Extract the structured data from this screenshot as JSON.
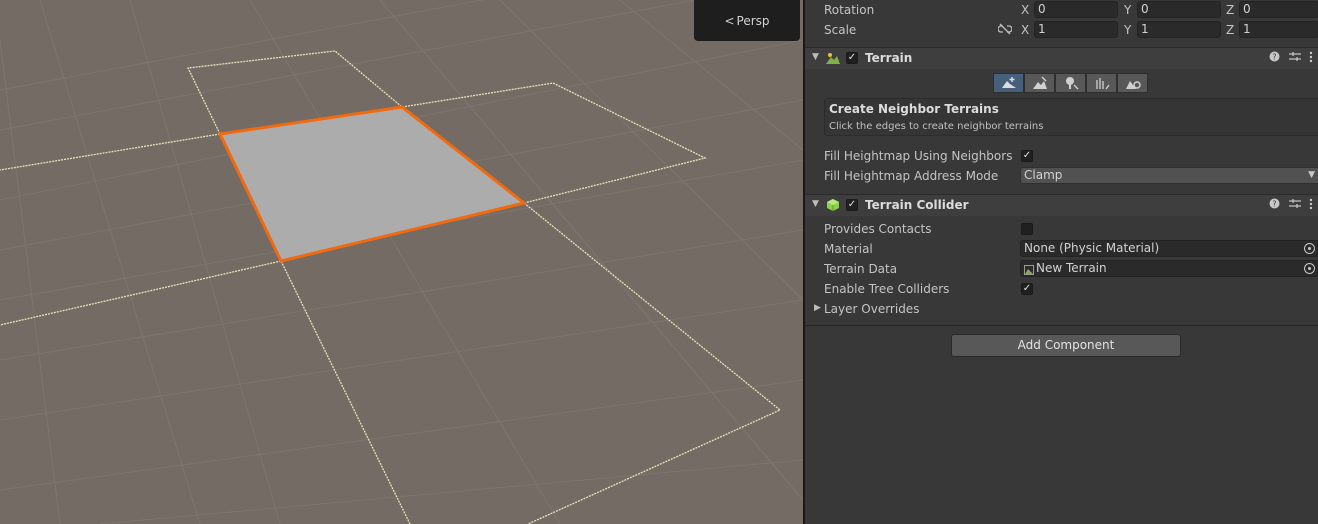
{
  "scene_view": {
    "persp_label": "Persp"
  },
  "transform": {
    "rotation": {
      "label": "Rotation",
      "x_axis": "X",
      "y_axis": "Y",
      "z_axis": "Z",
      "x": "0",
      "y": "0",
      "z": "0"
    },
    "scale": {
      "label": "Scale",
      "x_axis": "X",
      "y_axis": "Y",
      "z_axis": "Z",
      "x": "1",
      "y": "1",
      "z": "1"
    }
  },
  "terrain": {
    "title": "Terrain",
    "enabled": true,
    "tools": [
      "create-neighbor-terrains-tool",
      "paint-terrain-tool",
      "paint-trees-tool",
      "paint-details-tool",
      "terrain-settings-tool"
    ],
    "active_tool": 0,
    "info_title": "Create Neighbor Terrains",
    "info_text": "Click the edges to create neighbor terrains",
    "fill_heightmap_label": "Fill Heightmap Using Neighbors",
    "fill_heightmap_checked": true,
    "address_mode_label": "Fill Heightmap Address Mode",
    "address_mode_value": "Clamp"
  },
  "terrain_collider": {
    "title": "Terrain Collider",
    "enabled": true,
    "provides_contacts_label": "Provides Contacts",
    "provides_contacts_checked": false,
    "material_label": "Material",
    "material_value": "None (Physic Material)",
    "terrain_data_label": "Terrain Data",
    "terrain_data_value": "New Terrain",
    "enable_tree_colliders_label": "Enable Tree Colliders",
    "enable_tree_colliders_checked": true,
    "layer_overrides_label": "Layer Overrides"
  },
  "add_component_label": "Add Component",
  "colors": {
    "scene_ground": "#746c64",
    "selection_outline": "#f26a10",
    "neighbor_outline": "#e8e2bc",
    "inspector_bg": "#383838",
    "active_tool": "#46607c"
  }
}
